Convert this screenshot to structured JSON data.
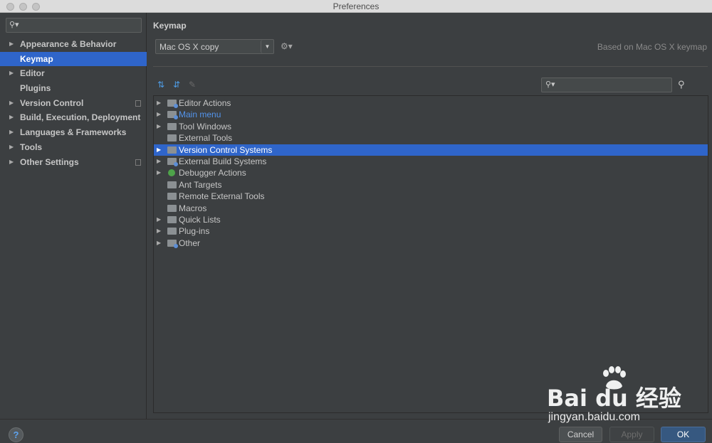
{
  "window": {
    "title": "Preferences"
  },
  "sidebar": {
    "search": {
      "placeholder": ""
    },
    "items": [
      {
        "label": "Appearance & Behavior",
        "expandable": true,
        "selected": false,
        "copy_icon": false
      },
      {
        "label": "Keymap",
        "expandable": false,
        "selected": true,
        "copy_icon": false
      },
      {
        "label": "Editor",
        "expandable": true,
        "selected": false,
        "copy_icon": false
      },
      {
        "label": "Plugins",
        "expandable": false,
        "selected": false,
        "copy_icon": false
      },
      {
        "label": "Version Control",
        "expandable": true,
        "selected": false,
        "copy_icon": true
      },
      {
        "label": "Build, Execution, Deployment",
        "expandable": true,
        "selected": false,
        "copy_icon": false
      },
      {
        "label": "Languages & Frameworks",
        "expandable": true,
        "selected": false,
        "copy_icon": false
      },
      {
        "label": "Tools",
        "expandable": true,
        "selected": false,
        "copy_icon": false
      },
      {
        "label": "Other Settings",
        "expandable": true,
        "selected": false,
        "copy_icon": true
      }
    ]
  },
  "keymap": {
    "section_title": "Keymap",
    "selected_keymap": "Mac OS X copy",
    "based_on": "Based on Mac OS X keymap",
    "tree_search": {
      "placeholder": ""
    },
    "tree": [
      {
        "label": "Editor Actions",
        "expandable": true,
        "link": false,
        "selected": false,
        "icon": "folder-special-icon"
      },
      {
        "label": "Main menu",
        "expandable": true,
        "link": true,
        "selected": false,
        "icon": "folder-special-icon"
      },
      {
        "label": "Tool Windows",
        "expandable": true,
        "link": false,
        "selected": false,
        "icon": "folder-icon"
      },
      {
        "label": "External Tools",
        "expandable": false,
        "link": false,
        "selected": false,
        "icon": "folder-icon"
      },
      {
        "label": "Version Control Systems",
        "expandable": true,
        "link": false,
        "selected": true,
        "icon": "folder-icon"
      },
      {
        "label": "External Build Systems",
        "expandable": true,
        "link": false,
        "selected": false,
        "icon": "folder-special-icon"
      },
      {
        "label": "Debugger Actions",
        "expandable": true,
        "link": false,
        "selected": false,
        "icon": "bug-icon"
      },
      {
        "label": "Ant Targets",
        "expandable": false,
        "link": false,
        "selected": false,
        "icon": "folder-icon"
      },
      {
        "label": "Remote External Tools",
        "expandable": false,
        "link": false,
        "selected": false,
        "icon": "folder-icon"
      },
      {
        "label": "Macros",
        "expandable": false,
        "link": false,
        "selected": false,
        "icon": "folder-icon"
      },
      {
        "label": "Quick Lists",
        "expandable": true,
        "link": false,
        "selected": false,
        "icon": "folder-icon"
      },
      {
        "label": "Plug-ins",
        "expandable": true,
        "link": false,
        "selected": false,
        "icon": "folder-icon"
      },
      {
        "label": "Other",
        "expandable": true,
        "link": false,
        "selected": false,
        "icon": "folder-special-icon"
      }
    ]
  },
  "buttons": {
    "help": "?",
    "cancel": "Cancel",
    "apply": "Apply",
    "ok": "OK"
  },
  "watermark": {
    "logo": "Bai du 经验",
    "url": "jingyan.baidu.com"
  },
  "colors": {
    "accent": "#2f65ca",
    "background": "#3c3f41",
    "link": "#5394ec"
  }
}
